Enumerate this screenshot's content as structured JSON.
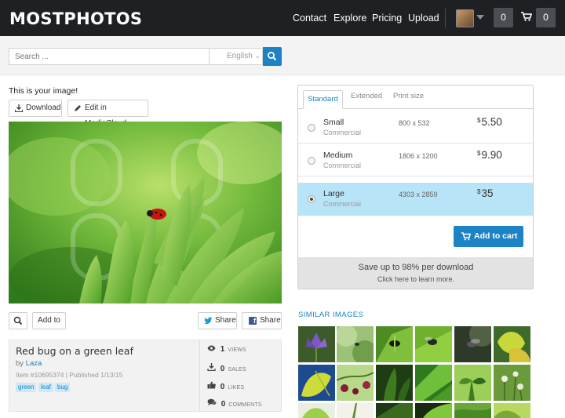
{
  "header": {
    "logo": "MOSTPHOTOS",
    "nav": [
      "Contact",
      "Explore",
      "Pricing",
      "Upload"
    ],
    "notifications_count": "0",
    "cart_count": "0"
  },
  "search": {
    "placeholder": "Search ...",
    "language": "English"
  },
  "left": {
    "your_image": "This is your image!",
    "download_label": "Download",
    "edit_label": "Edit in MediaCloud",
    "add_to_label": "Add to",
    "share_twitter": "Share",
    "share_facebook": "Share"
  },
  "image_info": {
    "title": "Red bug on a green leaf",
    "by": "by",
    "author": "Laza",
    "item_line": "Item #10695374 | Published 1/13/15",
    "tags": [
      "green",
      "leaf",
      "bug"
    ],
    "stats": [
      {
        "value": "1",
        "label": "VIEWS"
      },
      {
        "value": "0",
        "label": "SALES"
      },
      {
        "value": "0",
        "label": "LIKES"
      },
      {
        "value": "0",
        "label": "COMMENTS"
      }
    ]
  },
  "pricing": {
    "tabs": [
      "Standard",
      "Extended",
      "Print size"
    ],
    "active_tab": "Standard",
    "options": [
      {
        "name": "Small",
        "license": "Commercial",
        "dims": "800 x 532",
        "currency": "$",
        "price": "5.50",
        "selected": false
      },
      {
        "name": "Medium",
        "license": "Commercial",
        "dims": "1806 x 1200",
        "currency": "$",
        "price": "9.90",
        "selected": false
      },
      {
        "name": "Large",
        "license": "Commercial",
        "dims": "4303 x 2859",
        "currency": "$",
        "price": "35",
        "selected": true
      }
    ],
    "add_to_cart": "Add to cart",
    "save_line": "Save up to 98% per download",
    "learn_more": "Click here to learn more."
  },
  "similar": {
    "title": "SIMILAR IMAGES"
  },
  "colors": {
    "accent": "#1e83c4",
    "header_bg": "#1f2023",
    "selected_row": "#b8e4f8"
  }
}
